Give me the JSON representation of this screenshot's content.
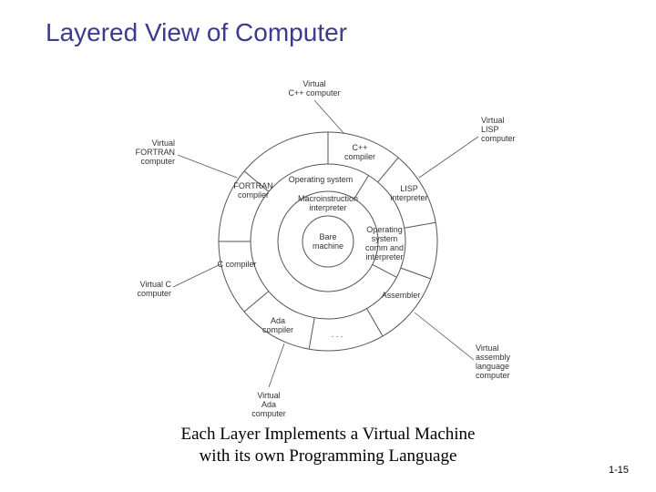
{
  "title": "Layered View of Computer",
  "caption_line1": "Each Layer Implements a Virtual Machine",
  "caption_line2": "with its own Programming Language",
  "page_number": "1-15",
  "diagram": {
    "center_label": "Bare\nmachine",
    "ring2_labels": [
      "Macroinstruction\ninterpreter"
    ],
    "ring3_labels": {
      "top": "Operating system",
      "right": "Operating\nsystem\ncomm and\ninterpreter"
    },
    "ring4_sectors": [
      "C++\ncompiler",
      "LISP\ninterpreter",
      "",
      "Assembler",
      "",
      ". . .",
      "Ada\ncompiler",
      "C compiler",
      "FORTRAN\ncompiler"
    ],
    "outer_callouts": [
      {
        "text": "Virtual\nC++ computer"
      },
      {
        "text": "Virtual\nLISP\ncomputer"
      },
      {
        "text": "Virtual\nassembly\nlanguage\ncomputer"
      },
      {
        "text": "Virtual\nAda\ncomputer"
      },
      {
        "text": "Virtual C\ncomputer"
      },
      {
        "text": "Virtual\nFORTRAN\ncomputer"
      }
    ]
  }
}
